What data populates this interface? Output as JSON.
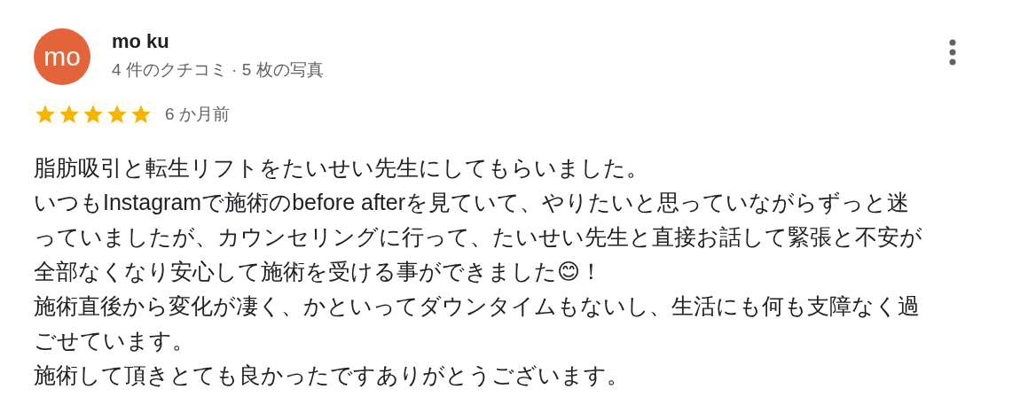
{
  "review": {
    "avatar": {
      "initials": "mo",
      "color": "#e4643a"
    },
    "author": "mo ku",
    "meta": "4 件のクチコミ · 5 枚の写真",
    "stars": 5,
    "time": "6 か月前",
    "paragraphs": [
      "脂肪吸引と転生リフトをたいせい先生にしてもらいました。",
      "いつもInstagramで施術のbefore afterを見ていて、やりたいと思っていながらずっと迷っていましたが、カウンセリングに行って、たいせい先生と直接お話して緊張と不安が全部なくなり安心して施術を受ける事ができました😊！",
      "施術直後から変化が凄く、かといってダウンタイムもないし、生活にも何も支障なく過ごせています。",
      "施術して頂きとても良かったですありがとうございます。"
    ]
  }
}
